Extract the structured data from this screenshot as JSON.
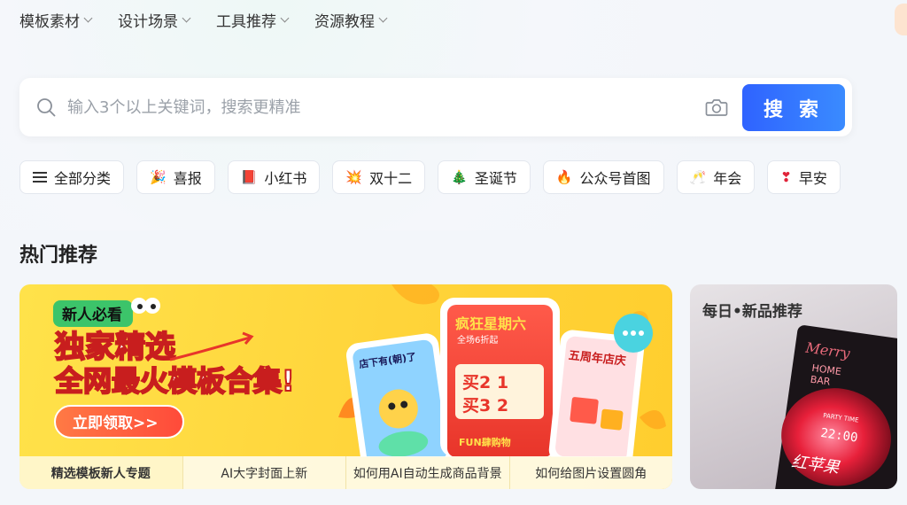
{
  "nav": [
    {
      "label": "模板素材"
    },
    {
      "label": "设计场景"
    },
    {
      "label": "工具推荐"
    },
    {
      "label": "资源教程"
    }
  ],
  "search": {
    "placeholder": "输入3个以上关键词，搜索更精准",
    "button_label": "搜 索",
    "camera_icon": "camera-icon",
    "search_icon": "search-icon"
  },
  "tags": [
    {
      "label": "全部分类",
      "icon": "menu-icon"
    },
    {
      "label": "喜报",
      "icon": "party-popper-icon",
      "glyph": "🎉"
    },
    {
      "label": "小红书",
      "icon": "red-book-icon",
      "glyph": "📕"
    },
    {
      "label": "双十二",
      "icon": "burst-icon",
      "glyph": "💥"
    },
    {
      "label": "圣诞节",
      "icon": "christmas-tree-icon",
      "glyph": "🎄"
    },
    {
      "label": "公众号首图",
      "icon": "fire-icon",
      "glyph": "🔥"
    },
    {
      "label": "年会",
      "icon": "champagne-icon",
      "glyph": "🥂"
    },
    {
      "label": "早安",
      "icon": "heart-icon",
      "glyph": "❣"
    }
  ],
  "section_title": "热门推荐",
  "banner": {
    "badge": "新人必看",
    "headline": "独家精选",
    "subheadline": "全网最火模板合集!",
    "cta": "立即领取>>",
    "card_left_title": "店下有(朝)了",
    "card_mid_title": "疯狂星期六",
    "card_mid_sub": "全场6折起",
    "card_mid_line1": "买2 1",
    "card_mid_line2": "买3 2",
    "card_mid_footer": "FUN肆购物",
    "card_right_title": "五周年店庆",
    "links": [
      {
        "label": "精选模板新人专题"
      },
      {
        "label": "AI大字封面上新"
      },
      {
        "label": "如何用AI自动生成商品背景"
      },
      {
        "label": "如何给图片设置圆角"
      }
    ],
    "colors": {
      "bg": "#ffd43a",
      "accent": "#e8352a",
      "cta": "#ff6a3d"
    }
  },
  "side_card": {
    "title": "每日•新品推荐",
    "art_text_1": "Merry",
    "art_text_2": "HOME",
    "art_text_3": "BAR",
    "art_text_4": "PARTY TIME",
    "art_text_5": "22:00",
    "art_text_6": "红苹果"
  }
}
